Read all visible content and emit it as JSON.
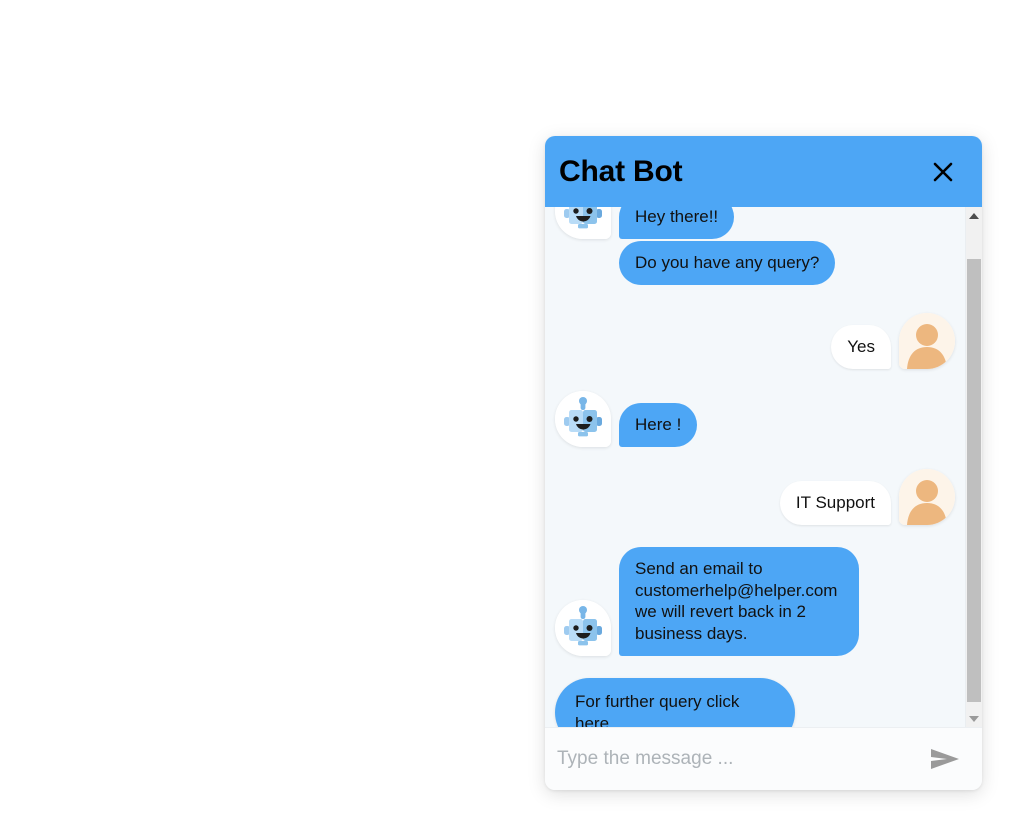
{
  "widget": {
    "title": "Chat Bot",
    "close_label": "×",
    "header_color": "#4da6f5",
    "bubble_color": "#4da6f5",
    "background_color": "#f4f8fb"
  },
  "messages": [
    {
      "id": "m1",
      "sender": "bot",
      "text": "Hey there!!",
      "avatar": "bot-avatar",
      "show_avatar": true,
      "style": "bubble"
    },
    {
      "id": "m2",
      "sender": "bot",
      "text": "Do you have any query?",
      "avatar": "",
      "show_avatar": false,
      "style": "bubble"
    },
    {
      "id": "m3",
      "sender": "user",
      "text": "Yes",
      "avatar": "user-avatar",
      "show_avatar": true,
      "style": "bubble"
    },
    {
      "id": "m4",
      "sender": "bot",
      "text": "Here !",
      "avatar": "bot-avatar",
      "show_avatar": true,
      "style": "bubble"
    },
    {
      "id": "m5",
      "sender": "user",
      "text": "IT Support",
      "avatar": "user-avatar",
      "show_avatar": true,
      "style": "bubble"
    },
    {
      "id": "m6",
      "sender": "bot",
      "text": "Send an email to customerhelp@helper.com we will revert back in 2 business days.",
      "avatar": "bot-avatar",
      "show_avatar": true,
      "style": "bubble"
    },
    {
      "id": "m7",
      "sender": "bot",
      "text": "For further query click here",
      "avatar": "",
      "show_avatar": false,
      "style": "pill"
    }
  ],
  "composer": {
    "placeholder": "Type the message ...",
    "value": "",
    "send_icon": "send-icon"
  },
  "scrollbar": {
    "up_arrow": "scroll-up-arrow-icon",
    "down_arrow": "scroll-down-arrow-icon",
    "orientation": "vertical"
  }
}
